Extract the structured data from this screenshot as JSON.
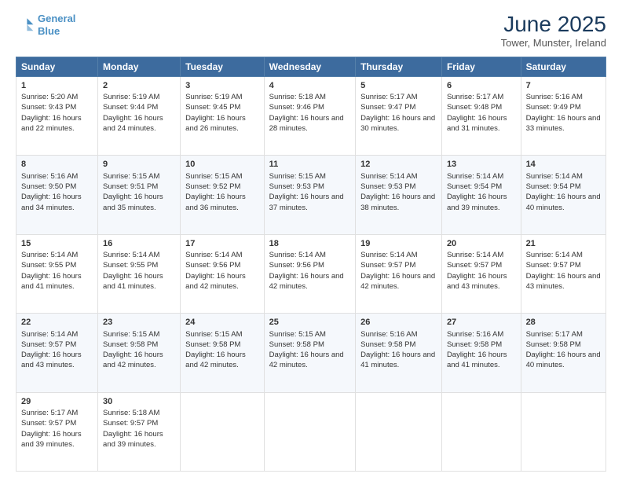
{
  "logo": {
    "line1": "General",
    "line2": "Blue"
  },
  "title": "June 2025",
  "subtitle": "Tower, Munster, Ireland",
  "header_days": [
    "Sunday",
    "Monday",
    "Tuesday",
    "Wednesday",
    "Thursday",
    "Friday",
    "Saturday"
  ],
  "weeks": [
    [
      {
        "day": "1",
        "sunrise": "Sunrise: 5:20 AM",
        "sunset": "Sunset: 9:43 PM",
        "daylight": "Daylight: 16 hours and 22 minutes."
      },
      {
        "day": "2",
        "sunrise": "Sunrise: 5:19 AM",
        "sunset": "Sunset: 9:44 PM",
        "daylight": "Daylight: 16 hours and 24 minutes."
      },
      {
        "day": "3",
        "sunrise": "Sunrise: 5:19 AM",
        "sunset": "Sunset: 9:45 PM",
        "daylight": "Daylight: 16 hours and 26 minutes."
      },
      {
        "day": "4",
        "sunrise": "Sunrise: 5:18 AM",
        "sunset": "Sunset: 9:46 PM",
        "daylight": "Daylight: 16 hours and 28 minutes."
      },
      {
        "day": "5",
        "sunrise": "Sunrise: 5:17 AM",
        "sunset": "Sunset: 9:47 PM",
        "daylight": "Daylight: 16 hours and 30 minutes."
      },
      {
        "day": "6",
        "sunrise": "Sunrise: 5:17 AM",
        "sunset": "Sunset: 9:48 PM",
        "daylight": "Daylight: 16 hours and 31 minutes."
      },
      {
        "day": "7",
        "sunrise": "Sunrise: 5:16 AM",
        "sunset": "Sunset: 9:49 PM",
        "daylight": "Daylight: 16 hours and 33 minutes."
      }
    ],
    [
      {
        "day": "8",
        "sunrise": "Sunrise: 5:16 AM",
        "sunset": "Sunset: 9:50 PM",
        "daylight": "Daylight: 16 hours and 34 minutes."
      },
      {
        "day": "9",
        "sunrise": "Sunrise: 5:15 AM",
        "sunset": "Sunset: 9:51 PM",
        "daylight": "Daylight: 16 hours and 35 minutes."
      },
      {
        "day": "10",
        "sunrise": "Sunrise: 5:15 AM",
        "sunset": "Sunset: 9:52 PM",
        "daylight": "Daylight: 16 hours and 36 minutes."
      },
      {
        "day": "11",
        "sunrise": "Sunrise: 5:15 AM",
        "sunset": "Sunset: 9:53 PM",
        "daylight": "Daylight: 16 hours and 37 minutes."
      },
      {
        "day": "12",
        "sunrise": "Sunrise: 5:14 AM",
        "sunset": "Sunset: 9:53 PM",
        "daylight": "Daylight: 16 hours and 38 minutes."
      },
      {
        "day": "13",
        "sunrise": "Sunrise: 5:14 AM",
        "sunset": "Sunset: 9:54 PM",
        "daylight": "Daylight: 16 hours and 39 minutes."
      },
      {
        "day": "14",
        "sunrise": "Sunrise: 5:14 AM",
        "sunset": "Sunset: 9:54 PM",
        "daylight": "Daylight: 16 hours and 40 minutes."
      }
    ],
    [
      {
        "day": "15",
        "sunrise": "Sunrise: 5:14 AM",
        "sunset": "Sunset: 9:55 PM",
        "daylight": "Daylight: 16 hours and 41 minutes."
      },
      {
        "day": "16",
        "sunrise": "Sunrise: 5:14 AM",
        "sunset": "Sunset: 9:55 PM",
        "daylight": "Daylight: 16 hours and 41 minutes."
      },
      {
        "day": "17",
        "sunrise": "Sunrise: 5:14 AM",
        "sunset": "Sunset: 9:56 PM",
        "daylight": "Daylight: 16 hours and 42 minutes."
      },
      {
        "day": "18",
        "sunrise": "Sunrise: 5:14 AM",
        "sunset": "Sunset: 9:56 PM",
        "daylight": "Daylight: 16 hours and 42 minutes."
      },
      {
        "day": "19",
        "sunrise": "Sunrise: 5:14 AM",
        "sunset": "Sunset: 9:57 PM",
        "daylight": "Daylight: 16 hours and 42 minutes."
      },
      {
        "day": "20",
        "sunrise": "Sunrise: 5:14 AM",
        "sunset": "Sunset: 9:57 PM",
        "daylight": "Daylight: 16 hours and 43 minutes."
      },
      {
        "day": "21",
        "sunrise": "Sunrise: 5:14 AM",
        "sunset": "Sunset: 9:57 PM",
        "daylight": "Daylight: 16 hours and 43 minutes."
      }
    ],
    [
      {
        "day": "22",
        "sunrise": "Sunrise: 5:14 AM",
        "sunset": "Sunset: 9:57 PM",
        "daylight": "Daylight: 16 hours and 43 minutes."
      },
      {
        "day": "23",
        "sunrise": "Sunrise: 5:15 AM",
        "sunset": "Sunset: 9:58 PM",
        "daylight": "Daylight: 16 hours and 42 minutes."
      },
      {
        "day": "24",
        "sunrise": "Sunrise: 5:15 AM",
        "sunset": "Sunset: 9:58 PM",
        "daylight": "Daylight: 16 hours and 42 minutes."
      },
      {
        "day": "25",
        "sunrise": "Sunrise: 5:15 AM",
        "sunset": "Sunset: 9:58 PM",
        "daylight": "Daylight: 16 hours and 42 minutes."
      },
      {
        "day": "26",
        "sunrise": "Sunrise: 5:16 AM",
        "sunset": "Sunset: 9:58 PM",
        "daylight": "Daylight: 16 hours and 41 minutes."
      },
      {
        "day": "27",
        "sunrise": "Sunrise: 5:16 AM",
        "sunset": "Sunset: 9:58 PM",
        "daylight": "Daylight: 16 hours and 41 minutes."
      },
      {
        "day": "28",
        "sunrise": "Sunrise: 5:17 AM",
        "sunset": "Sunset: 9:58 PM",
        "daylight": "Daylight: 16 hours and 40 minutes."
      }
    ],
    [
      {
        "day": "29",
        "sunrise": "Sunrise: 5:17 AM",
        "sunset": "Sunset: 9:57 PM",
        "daylight": "Daylight: 16 hours and 39 minutes."
      },
      {
        "day": "30",
        "sunrise": "Sunrise: 5:18 AM",
        "sunset": "Sunset: 9:57 PM",
        "daylight": "Daylight: 16 hours and 39 minutes."
      },
      {
        "day": "",
        "sunrise": "",
        "sunset": "",
        "daylight": ""
      },
      {
        "day": "",
        "sunrise": "",
        "sunset": "",
        "daylight": ""
      },
      {
        "day": "",
        "sunrise": "",
        "sunset": "",
        "daylight": ""
      },
      {
        "day": "",
        "sunrise": "",
        "sunset": "",
        "daylight": ""
      },
      {
        "day": "",
        "sunrise": "",
        "sunset": "",
        "daylight": ""
      }
    ]
  ]
}
